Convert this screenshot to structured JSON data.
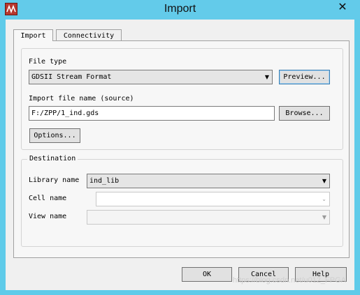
{
  "window": {
    "title": "Import",
    "close_glyph": "✕",
    "icon": "app-icon"
  },
  "tabs": [
    {
      "label": "Import",
      "active": true
    },
    {
      "label": "Connectivity",
      "active": false
    }
  ],
  "file_type": {
    "label": "File type",
    "value": "GDSII Stream Format",
    "preview_button": "Preview..."
  },
  "import_file": {
    "label": "Import file name (source)",
    "value": "F:/ZPP/1_ind.gds",
    "browse_button": "Browse..."
  },
  "options_button": "Options...",
  "destination": {
    "legend": "Destination",
    "library_label": "Library name",
    "library_value": "ind_lib",
    "cell_label": "Cell name",
    "cell_value": "",
    "view_label": "View name",
    "view_value": ""
  },
  "footer": {
    "ok": "OK",
    "cancel": "Cancel",
    "help": "Help"
  },
  "watermark": "https://blog.csdn.net/u012_FPGA",
  "colors": {
    "titlebar": "#63cbea",
    "dialog": "#f0f0f0",
    "button": "#e1e1e1",
    "app_icon": "#b8372d"
  }
}
